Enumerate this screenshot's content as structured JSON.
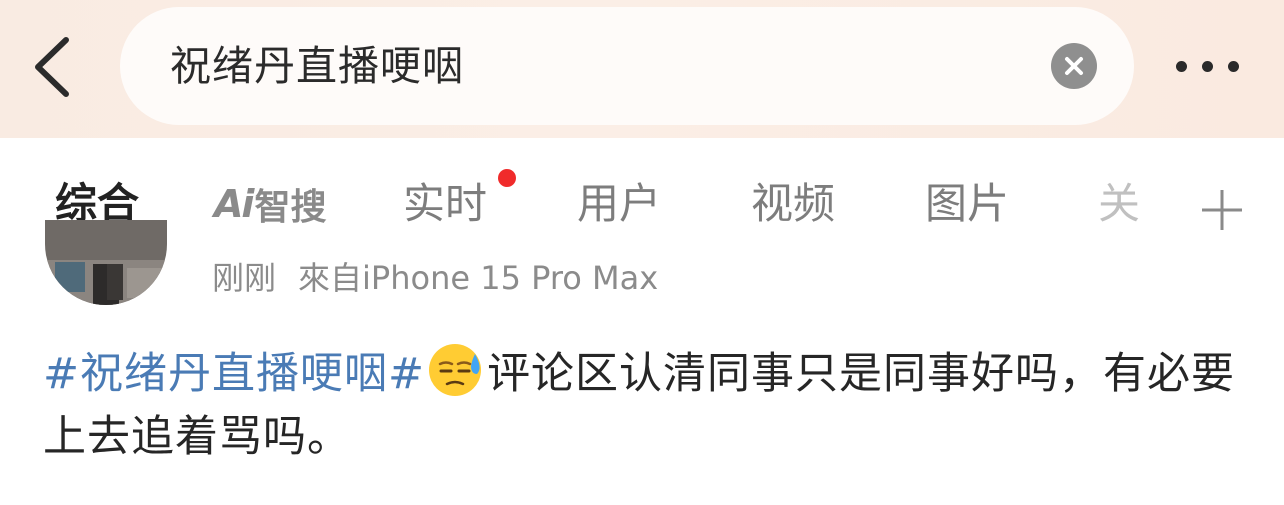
{
  "search": {
    "query": "祝绪丹直播哽咽"
  },
  "tabs": [
    {
      "label": "综合"
    },
    {
      "label": "智搜"
    },
    {
      "label": "实时"
    },
    {
      "label": "用户"
    },
    {
      "label": "视频"
    },
    {
      "label": "图片"
    },
    {
      "label": "关"
    }
  ],
  "ai_logo": "Ai",
  "post": {
    "time": "刚刚",
    "source": "來自iPhone 15 Pro Max",
    "hashtag": "#祝绪丹直播哽咽#",
    "text": "评论区认清同事只是同事好吗，有必要上去追着骂吗。",
    "emoji": "downcast-face-with-sweat-icon"
  },
  "colors": {
    "accent": "#ff8200",
    "link": "#4a7bb5",
    "notification_dot": "#f02b2b"
  }
}
